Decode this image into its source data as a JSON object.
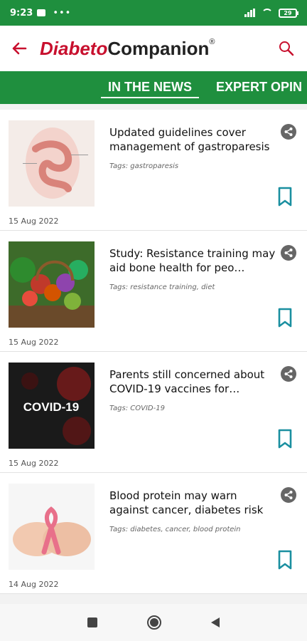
{
  "status_bar": {
    "time": "9:23",
    "battery": "29"
  },
  "app_bar": {
    "brand_part1": "Diabeto",
    "brand_part2": "Companion",
    "brand_mark": "®"
  },
  "tabs": [
    {
      "label": "IN THE NEWS",
      "active": true
    },
    {
      "label": "EXPERT OPIN"
    }
  ],
  "articles": [
    {
      "title": "Updated guidelines cover management of gastroparesis",
      "tags": "Tags: gastroparesis",
      "date": "15 Aug 2022",
      "thumb": "anatomy-illustration"
    },
    {
      "title": "Study: Resistance training may aid bone health for peo…",
      "tags": "Tags: resistance training, diet",
      "date": "15 Aug 2022",
      "thumb": "vegetable-basket"
    },
    {
      "title": "Parents still concerned about COVID-19 vaccines for…",
      "tags": "Tags: COVID-19",
      "date": "15 Aug 2022",
      "thumb": "covid-image",
      "thumb_text": "COVID-19"
    },
    {
      "title": "Blood protein may warn against cancer, diabetes risk",
      "tags": "Tags: diabetes, cancer, blood protein",
      "date": "14 Aug 2022",
      "thumb": "ribbon-hands"
    }
  ],
  "colors": {
    "primary_green": "#1f8f3e",
    "brand_red": "#c8102e",
    "bookmark_teal": "#1a8fa0"
  }
}
